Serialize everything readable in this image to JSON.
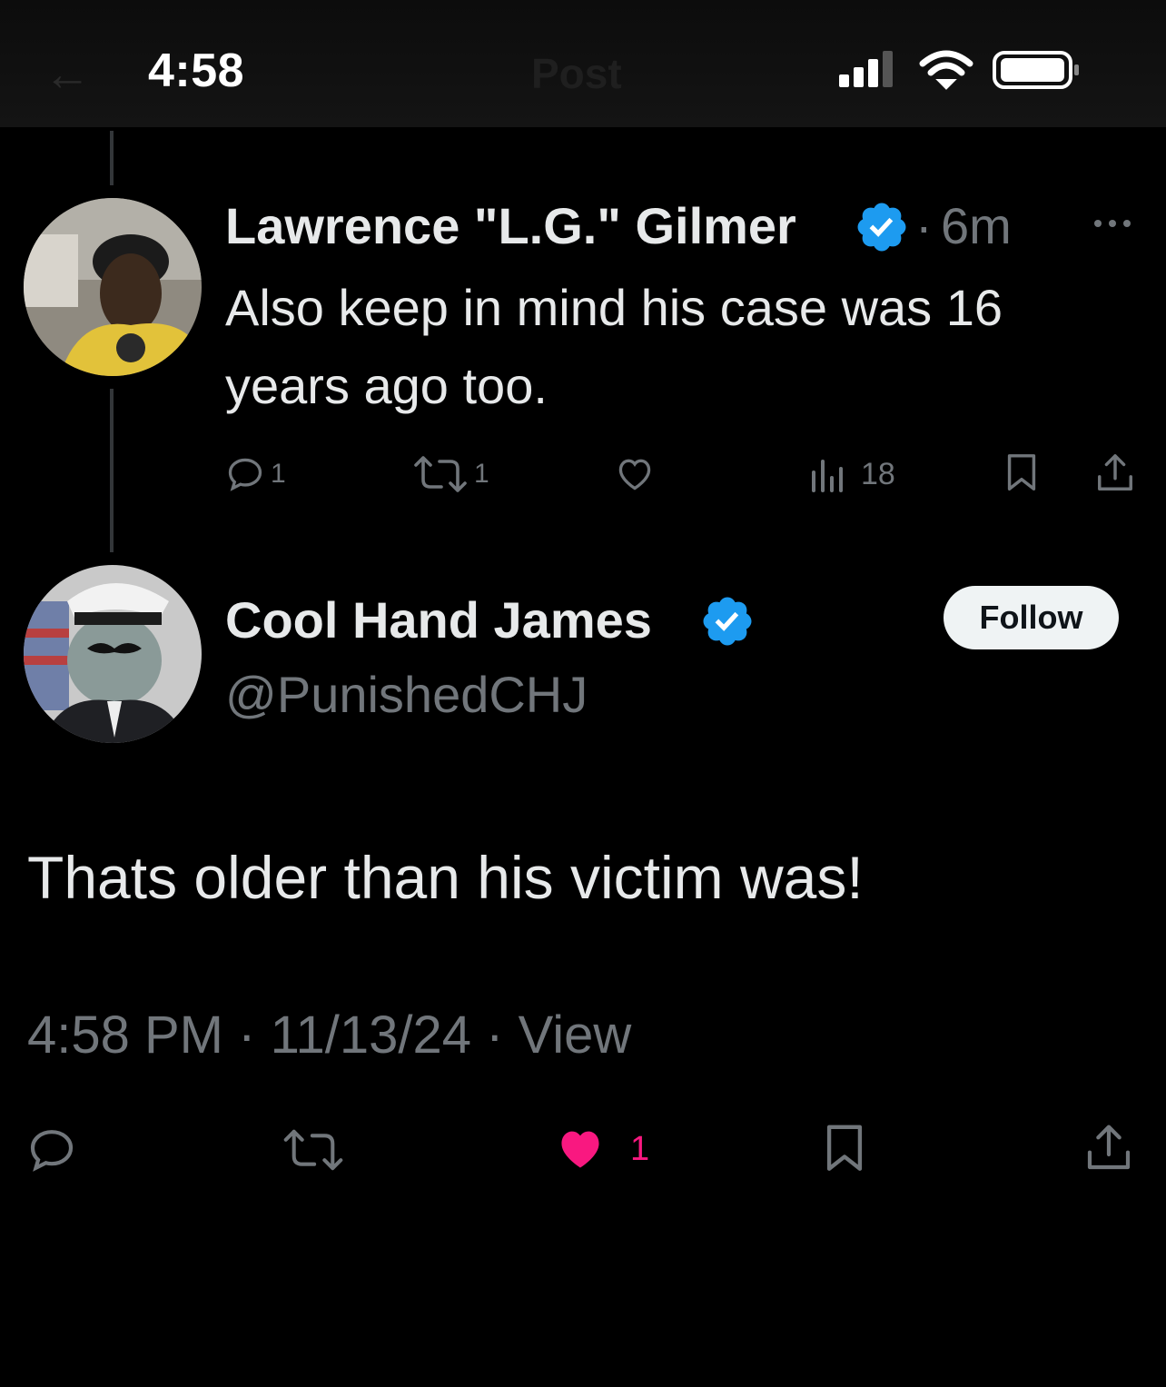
{
  "status_bar": {
    "time": "4:58",
    "ghost_nav_title": "Post"
  },
  "parent_tweet": {
    "author_name": "Lawrence \"L.G.\" Gilmer",
    "verified": true,
    "separator": "·",
    "age": "6m",
    "text_line1": "Also keep in mind his case was 16",
    "text_line2": "years ago too.",
    "actions": {
      "replies": "1",
      "reposts": "1",
      "likes": "",
      "views": "18"
    }
  },
  "main_tweet": {
    "author_name": "Cool Hand James",
    "verified": true,
    "handle": "@PunishedCHJ",
    "follow_label": "Follow",
    "text": "Thats older than his victim was!",
    "timestamp_time": "4:58 PM",
    "timestamp_sep": "·",
    "timestamp_date": "11/13/24",
    "timestamp_view": "View",
    "actions": {
      "likes": "1"
    }
  },
  "colors": {
    "background": "#000000",
    "text": "#e7e9ea",
    "muted": "#71767b",
    "verified_blue": "#1d9bf0",
    "liked_pink": "#f91880"
  },
  "icons": [
    "back-arrow-icon",
    "signal-icon",
    "wifi-icon",
    "battery-icon",
    "verified-badge-icon",
    "more-icon",
    "reply-icon",
    "repost-icon",
    "like-icon",
    "views-icon",
    "bookmark-icon",
    "share-icon"
  ]
}
